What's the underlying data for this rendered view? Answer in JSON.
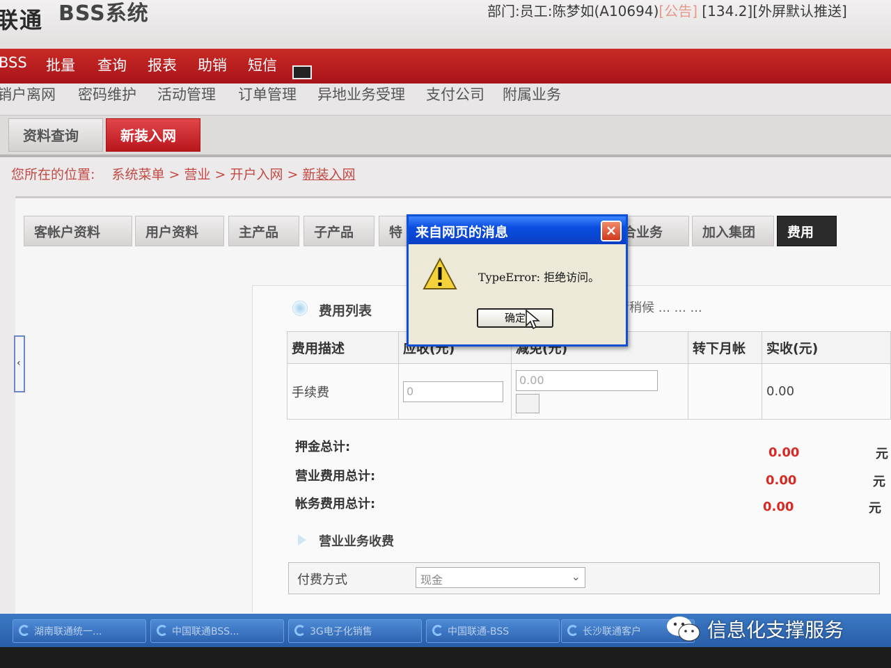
{
  "header": {
    "brand": "联通",
    "system_title": "BSS系统",
    "user_info": "部门:员工:陈梦如(A10694)",
    "notice_label": "[公告]",
    "session_info": "[134.2][外屏默认推送]"
  },
  "top_menu": [
    "BSS",
    "批量",
    "查询",
    "报表",
    "助销",
    "短信"
  ],
  "sub_menu": [
    "销户离网",
    "密码维护",
    "活动管理",
    "订单管理",
    "异地业务受理",
    "支付公司",
    "附属业务"
  ],
  "page_tabs": {
    "query": "资料查询",
    "new_install": "新装入网"
  },
  "breadcrumb": {
    "prefix": "您所在的位置:",
    "path": "系统菜单 > 营业 > 开户入网 >",
    "current": "新装入网"
  },
  "inner_tabs": [
    "客帐户资料",
    "用户资料",
    "主产品",
    "子产品",
    "特",
    "合业务",
    "加入集团",
    "费用"
  ],
  "fee_section": {
    "title": "费用列表",
    "waiting": "请稍候 ... ... ..."
  },
  "fee_table": {
    "headers": [
      "费用描述",
      "应收(元)",
      "减免(元)",
      "转下月帐",
      "实收(元)"
    ],
    "rows": [
      {
        "desc": "手续费",
        "receivable": "0",
        "discount": "0.00",
        "actual": "0.00"
      }
    ]
  },
  "totals": [
    {
      "label": "押金总计:",
      "value": "0.00",
      "unit": "元"
    },
    {
      "label": "营业费用总计:",
      "value": "0.00",
      "unit": "元"
    },
    {
      "label": "帐务费用总计:",
      "value": "0.00",
      "unit": "元"
    }
  ],
  "business": {
    "title": "营业业务收费",
    "pay_label": "付费方式",
    "pay_value": "现金"
  },
  "taskbar": [
    "湖南联通统一...",
    "中国联通BSS...",
    "3G电子化销售",
    "中国联通-BSS",
    "长沙联通客户"
  ],
  "watermark": "信息化支撑服务",
  "dialog": {
    "title": "来自网页的消息",
    "message": "TypeError: 拒绝访问。",
    "ok_label": "确定",
    "close_symbol": "×"
  },
  "colors": {
    "menu_red": "#b81c1f",
    "dialog_blue": "#0a4de0",
    "total_red": "#d72a24"
  }
}
